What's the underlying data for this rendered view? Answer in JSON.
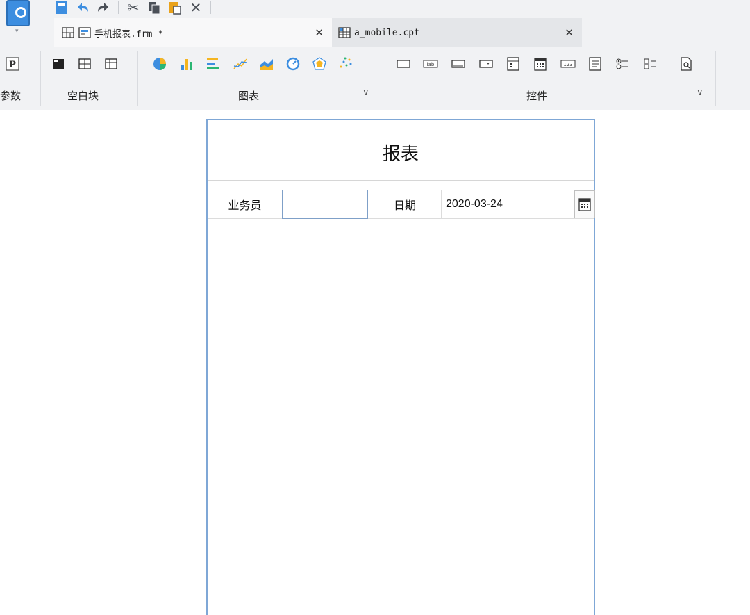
{
  "toolbar": {
    "quick_icons": [
      "save-icon",
      "undo-icon",
      "redo-icon",
      "cut-icon",
      "copy-icon",
      "paste-icon",
      "delete-icon"
    ]
  },
  "tabs": [
    {
      "label": "手机报表.frm *",
      "active": true
    },
    {
      "label": "a_mobile.cpt",
      "active": false
    }
  ],
  "ribbon": {
    "params_label": "参数",
    "blank_label": "空白块",
    "chart_label": "图表",
    "controls_label": "控件"
  },
  "report": {
    "title": "报表",
    "salesman_label": "业务员",
    "salesman_value": "",
    "date_label": "日期",
    "date_value": "2020-03-24"
  },
  "colors": {
    "accent": "#3d8ee0",
    "canvas_border": "#7fa7d6",
    "toolbar_bg": "#f1f2f4"
  }
}
